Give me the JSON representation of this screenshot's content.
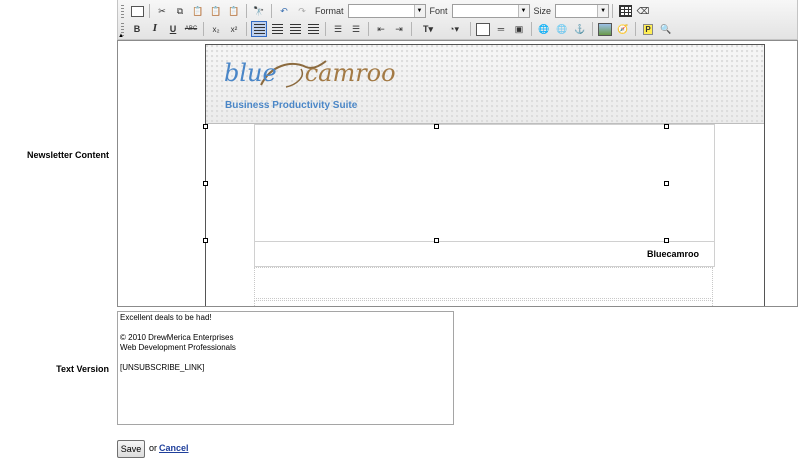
{
  "labels": {
    "newsletter_content": "Newsletter Content",
    "text_version": "Text Version"
  },
  "toolbar": {
    "format_label": "Format",
    "font_label": "Font",
    "size_label": "Size",
    "format_value": "",
    "font_value": "",
    "size_value": "",
    "buttons_row1": [
      "source-icon",
      "cut-icon",
      "copy-icon",
      "paste-icon",
      "paste-text-icon",
      "paste-word-icon",
      "find-icon",
      "undo-icon",
      "redo-icon"
    ],
    "buttons_row1_right": [
      "table-icon",
      "eraser-icon"
    ],
    "buttons_row2": [
      {
        "name": "bold-button",
        "glyph": "B"
      },
      {
        "name": "italic-button",
        "glyph": "I"
      },
      {
        "name": "underline-button",
        "glyph": "U"
      },
      {
        "name": "strikethrough-button",
        "glyph": "ABC"
      },
      {
        "name": "subscript-button",
        "glyph": "x₂"
      },
      {
        "name": "superscript-button",
        "glyph": "x²"
      }
    ],
    "preview_glyph": "P"
  },
  "editor": {
    "logo_blue": "blue",
    "logo_camroo": "camroo",
    "logo_tagline": "Business Productivity Suite",
    "brand_text": "Bluecamroo"
  },
  "text_version": {
    "lines": [
      "Excellent deals to be had!",
      "",
      "© 2010 DrewMerica Enterprises",
      "Web Development Professionals",
      "",
      "[UNSUBSCRIBE_LINK]"
    ]
  },
  "actions": {
    "save_label": "Save",
    "or_text": "or",
    "cancel_label": "Cancel"
  },
  "colors": {
    "logo_blue": "#4a86c7",
    "logo_brown": "#a37a45",
    "cancel_link": "#1f3f9b",
    "active_button": "#c1d2ee"
  }
}
